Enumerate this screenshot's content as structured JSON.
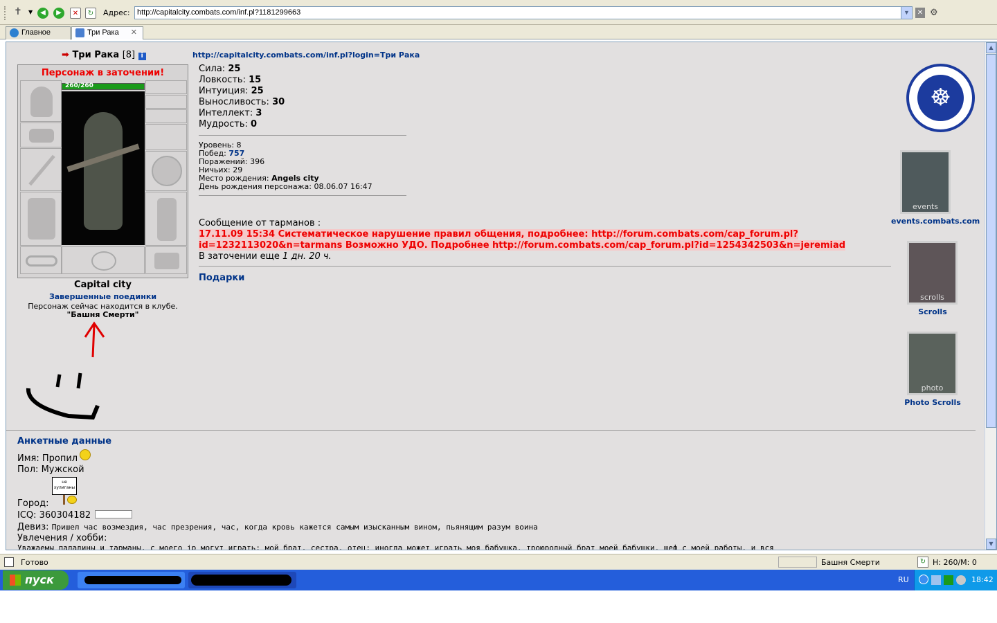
{
  "browser": {
    "address_label": "Адрес:",
    "url": "http://capitalcity.combats.com/inf.pl?1181299663",
    "tabs": [
      {
        "label": "Главное"
      },
      {
        "label": "Три Рака"
      }
    ],
    "tab_close": "✕"
  },
  "character": {
    "name": "Три Рака",
    "level": "[8]",
    "prison_notice": "Персонаж в заточении!",
    "hp_bar": "260/260",
    "city": "Capital city",
    "battles_link": "Завершенные поединки",
    "location_text": "Персонаж сейчас находится в клубе.",
    "location_name": "\"Башня Смерти\""
  },
  "info_url": "http://capitalcity.combats.com/inf.pl?login=Три Рака",
  "stats": [
    {
      "label": "Сила:",
      "value": "25"
    },
    {
      "label": "Ловкость:",
      "value": "15"
    },
    {
      "label": "Интуиция:",
      "value": "25"
    },
    {
      "label": "Выносливость:",
      "value": "30"
    },
    {
      "label": "Интеллект:",
      "value": "3"
    },
    {
      "label": "Мудрость:",
      "value": "0"
    }
  ],
  "records": {
    "level": {
      "label": "Уровень:",
      "value": "8"
    },
    "wins": {
      "label": "Побед:",
      "value": "757"
    },
    "losses": {
      "label": "Поражений:",
      "value": "396"
    },
    "draws": {
      "label": "Ничьих:",
      "value": "29"
    },
    "birthplace": {
      "label": "Место рождения:",
      "value": "Angels city"
    },
    "birthday": {
      "label": "День рождения персонажа:",
      "value": "08.06.07 16:47"
    }
  },
  "message": {
    "header": "Сообщение от тарманов :",
    "line1": "17.11.09 15:34 Систематическое нарушение правил общения, подробнее: http://forum.combats.com/cap_forum.pl?",
    "line2": "id=1232113020&n=tarmans Возможно УДО. Подробнее http://forum.combats.com/cap_forum.pl?id=1254342503&n=jeremiad",
    "prison_prefix": "В заточении еще",
    "prison_time": "1 дн. 20 ч."
  },
  "gifts_label": "Подарки",
  "sidebar": {
    "events_banner": "events",
    "events_label": "events.combats.com",
    "scrolls_banner": "scrolls",
    "scrolls_label": "Scrolls",
    "photo_banner": "photo",
    "photo_label": "Photo Scrolls"
  },
  "profile": {
    "heading": "Анкетные данные",
    "name_label": "Имя:",
    "name_value": "Пропил",
    "gender_label": "Пол:",
    "gender_value": "Мужской",
    "sign_text": "не хулиганы",
    "city_label": "Город:",
    "icq_label": "ICQ:",
    "icq_value": "360304182",
    "motto_label": "Девиз:",
    "motto_value": "Пришел час возмездия, час презрения, час, когда кровь кажется самым изысканным вином, пьянящим разум воина",
    "hobby_label": "Увлечения / хобби:",
    "hobby_value": "Уважаемы паладины и тарманы, с моего ip могут играть: мой брат, сестра, отец; иногда может играть моя бабушка, троюродный брат моей бабушки, шеф с моей работы, и вся"
  },
  "status": {
    "text": "Готово",
    "zone": "Башня Смерти",
    "hp": "H: 260/M: 0"
  },
  "taskbar": {
    "start": "пуск",
    "lang": "RU",
    "time": "18:42"
  }
}
